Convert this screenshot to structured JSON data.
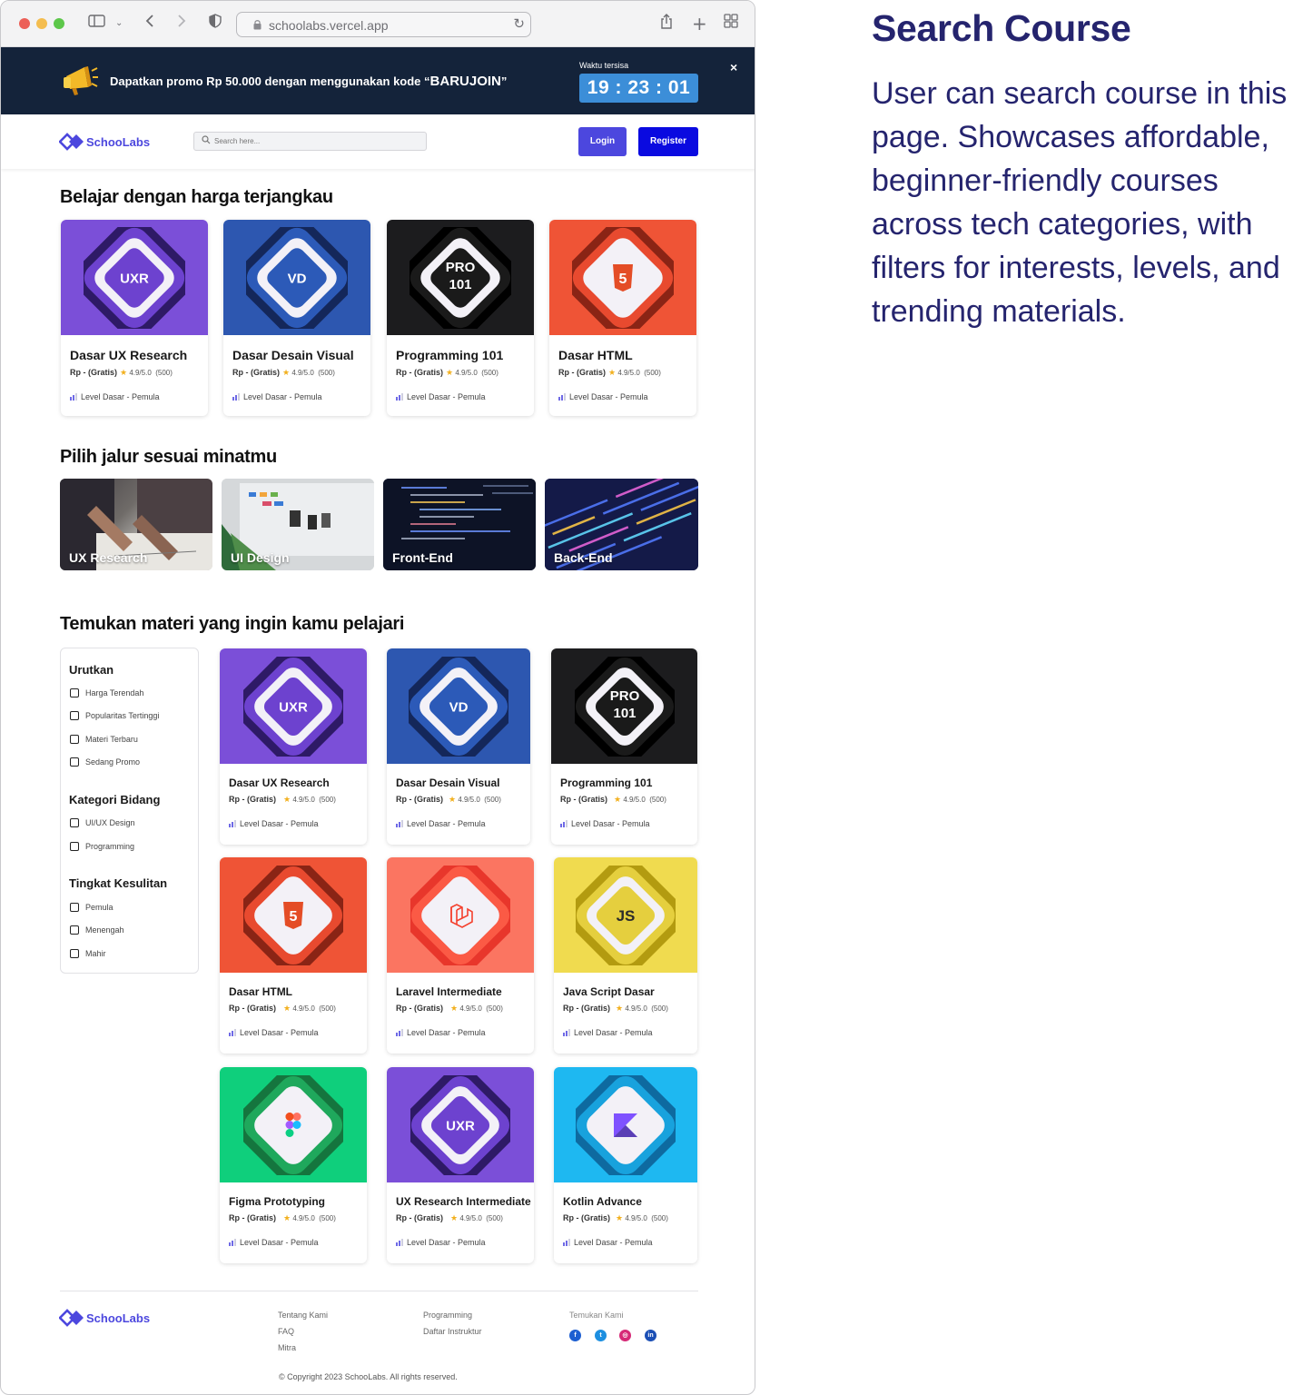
{
  "browser": {
    "url": "schoolabs.vercel.app"
  },
  "promo": {
    "text": "Dapatkan promo Rp 50.000 dengan menggunakan kode “",
    "code": "BARUJOIN",
    "text_end": "”",
    "timer_label": "Waktu tersisa",
    "timer": "19 : 23 : 01",
    "close": "×"
  },
  "nav": {
    "brand": "SchooLabs",
    "search_placeholder": "Search here...",
    "login": "Login",
    "register": "Register"
  },
  "sections": {
    "affordable": "Belajar dengan harga terjangkau",
    "paths": "Pilih jalur sesuai minatmu",
    "discover": "Temukan materi yang ingin kamu pelajari"
  },
  "featured": [
    {
      "title": "Dasar UX Research",
      "price": "Rp - (Gratis)",
      "rating": "4.9/5.0",
      "reviews": "(500)",
      "level": "Level Dasar - Pemula",
      "badge": "UXR"
    },
    {
      "title": "Dasar Desain Visual",
      "price": "Rp - (Gratis)",
      "rating": "4.9/5.0",
      "reviews": "(500)",
      "level": "Level Dasar - Pemula",
      "badge": "VD"
    },
    {
      "title": "Programming 101",
      "price": "Rp - (Gratis)",
      "rating": "4.9/5.0",
      "reviews": "(500)",
      "level": "Level Dasar - Pemula",
      "badge": "PRO 101"
    },
    {
      "title": "Dasar HTML",
      "price": "Rp - (Gratis)",
      "rating": "4.9/5.0",
      "reviews": "(500)",
      "level": "Level Dasar - Pemula",
      "badge": "5"
    }
  ],
  "paths": [
    "UX Research",
    "UI Design",
    "Front-End",
    "Back-End"
  ],
  "filters": {
    "sort_title": "Urutkan",
    "sort": [
      "Harga Terendah",
      "Popularitas Tertinggi",
      "Materi Terbaru",
      "Sedang Promo"
    ],
    "category_title": "Kategori Bidang",
    "category": [
      "UI/UX Design",
      "Programming"
    ],
    "level_title": "Tingkat Kesulitan",
    "level": [
      "Pemula",
      "Menengah",
      "Mahir"
    ]
  },
  "courses": [
    {
      "title": "Dasar UX Research",
      "price": "Rp - (Gratis)",
      "rating": "4.9/5.0",
      "reviews": "(500)",
      "level": "Level Dasar - Pemula",
      "badge": "UXR"
    },
    {
      "title": "Dasar Desain Visual",
      "price": "Rp - (Gratis)",
      "rating": "4.9/5.0",
      "reviews": "(500)",
      "level": "Level Dasar - Pemula",
      "badge": "VD"
    },
    {
      "title": "Programming 101",
      "price": "Rp - (Gratis)",
      "rating": "4.9/5.0",
      "reviews": "(500)",
      "level": "Level Dasar - Pemula",
      "badge": "PRO 101"
    },
    {
      "title": "Dasar HTML",
      "price": "Rp - (Gratis)",
      "rating": "4.9/5.0",
      "reviews": "(500)",
      "level": "Level Dasar - Pemula",
      "badge": "5"
    },
    {
      "title": "Laravel Intermediate",
      "price": "Rp - (Gratis)",
      "rating": "4.9/5.0",
      "reviews": "(500)",
      "level": "Level Dasar - Pemula",
      "badge": "laravel"
    },
    {
      "title": "Java Script Dasar",
      "price": "Rp - (Gratis)",
      "rating": "4.9/5.0",
      "reviews": "(500)",
      "level": "Level Dasar - Pemula",
      "badge": "JS"
    },
    {
      "title": "Figma Prototyping",
      "price": "Rp - (Gratis)",
      "rating": "4.9/5.0",
      "reviews": "(500)",
      "level": "Level Dasar - Pemula",
      "badge": "figma"
    },
    {
      "title": "UX Research Intermediate",
      "price": "Rp - (Gratis)",
      "rating": "4.9/5.0",
      "reviews": "(500)",
      "level": "Level Dasar - Pemula",
      "badge": "UXR"
    },
    {
      "title": "Kotlin Advance",
      "price": "Rp - (Gratis)",
      "rating": "4.9/5.0",
      "reviews": "(500)",
      "level": "Level Dasar - Pemula",
      "badge": "kotlin"
    }
  ],
  "footer": {
    "brand": "SchooLabs",
    "col1": [
      "Tentang Kami",
      "FAQ",
      "Mitra"
    ],
    "col2": [
      "Programming",
      "Daftar Instruktur"
    ],
    "col3_title": "Temukan Kami",
    "copyright": "© Copyright 2023 SchooLabs.  All rights reserved."
  },
  "side": {
    "title": "Search Course",
    "description": "User can search course in this page. Showcases affordable, beginner-friendly courses across tech categories, with filters for interests, levels, and trending materials."
  },
  "colors": {
    "brand": "#4c47de",
    "register": "#0a0ae0",
    "promo_bg": "#14233a",
    "timer_bg": "#3c8ed8",
    "heading": "#25246e"
  }
}
